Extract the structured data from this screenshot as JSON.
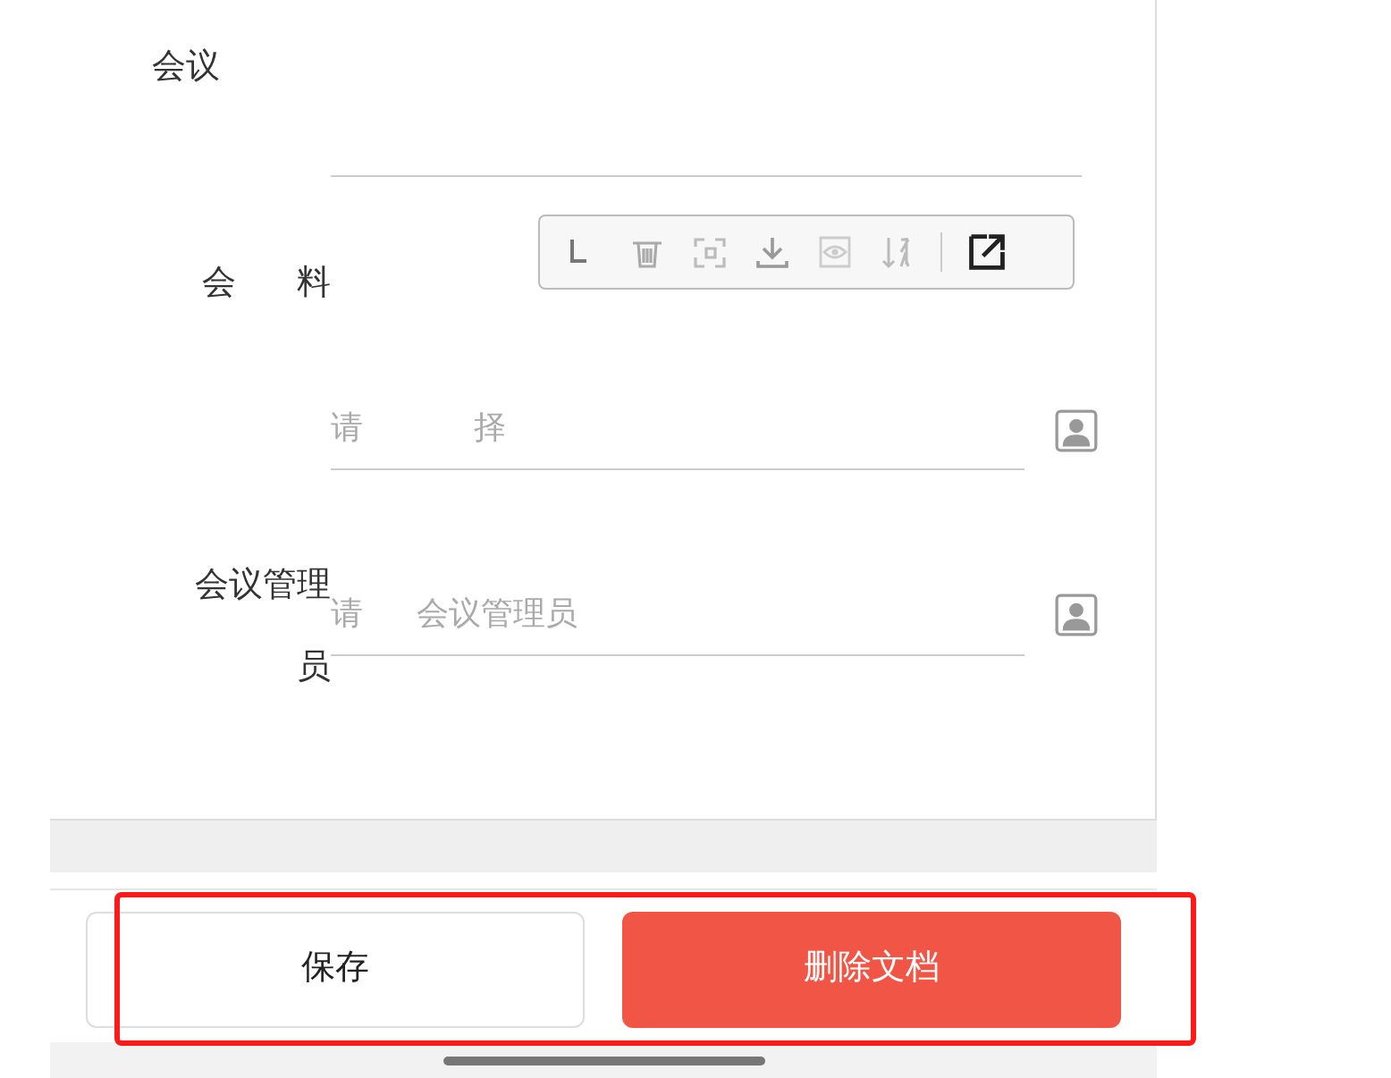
{
  "form": {
    "fields": [
      {
        "kind": "text",
        "label_parts": [
          "会议"
        ]
      },
      {
        "kind": "attachments",
        "label_parts": [
          "会",
          "料"
        ]
      },
      {
        "kind": "picker",
        "placeholder_parts": [
          "请",
          "择"
        ]
      },
      {
        "kind": "picker",
        "label_parts": [
          "会议管理",
          "员"
        ],
        "placeholder_parts": [
          "请",
          "会议管理员"
        ]
      }
    ]
  },
  "actions": [
    {
      "label": "保存",
      "kind": "secondary"
    },
    {
      "label": "删除文档",
      "kind": "danger"
    }
  ]
}
